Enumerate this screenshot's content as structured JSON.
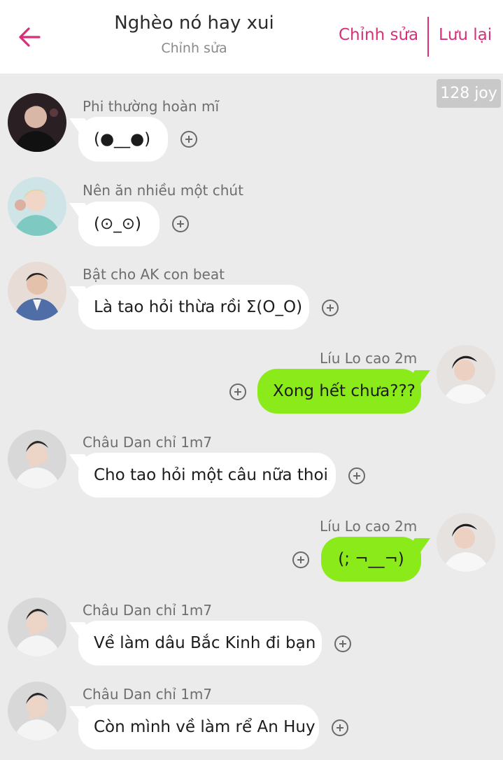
{
  "header": {
    "title": "Nghèo nó hay xui",
    "subtitle": "Chỉnh sửa",
    "edit_label": "Chỉnh sửa",
    "save_label": "Lưu lại",
    "accent_color": "#d6307a"
  },
  "badge": "128 joy",
  "messages": [
    {
      "side": "left",
      "name": "Phi thường hoàn mĩ",
      "text": "(●__●)",
      "avatar": "avatar-dark-outfit"
    },
    {
      "side": "left",
      "name": "Nên ăn nhiều một chút",
      "text": "(⊙_⊙)",
      "avatar": "avatar-teal-outfit"
    },
    {
      "side": "left",
      "name": "Bật cho AK con beat",
      "text": "Là tao hỏi thừa rồi Σ(O_O)",
      "avatar": "avatar-blue-blazer"
    },
    {
      "side": "right",
      "name": "Líu Lo cao 2m",
      "text": "Xong hết chưa???",
      "avatar": "avatar-white-shirt"
    },
    {
      "side": "left",
      "name": "Châu Dan chỉ 1m7",
      "text": "Cho tao hỏi một câu nữa thoi",
      "avatar": "avatar-v-sign"
    },
    {
      "side": "right",
      "name": "Líu Lo cao 2m",
      "text": "(;  ¬__¬)",
      "avatar": "avatar-white-shirt"
    },
    {
      "side": "left",
      "name": "Châu Dan chỉ 1m7",
      "text": "Về làm dâu Bắc Kinh đi bạn",
      "avatar": "avatar-v-sign"
    },
    {
      "side": "left",
      "name": "Châu Dan chỉ 1m7",
      "text": "Còn mình về làm rể An Huy",
      "avatar": "avatar-v-sign"
    }
  ],
  "colors": {
    "background": "#ebebeb",
    "left_bubble": "#ffffff",
    "right_bubble": "#8bea1a"
  }
}
